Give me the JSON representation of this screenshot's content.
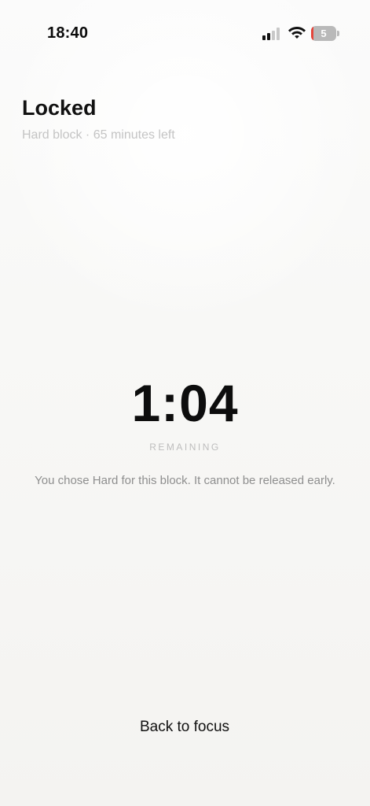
{
  "status_bar": {
    "time": "18:40",
    "signal_icon": "cellular-signal-icon",
    "signal_bars_active": 2,
    "signal_bars_total": 4,
    "wifi_icon": "wifi-icon",
    "battery_icon": "battery-icon",
    "battery_level": "5",
    "battery_fill_color": "#e5453b"
  },
  "header": {
    "title": "Locked",
    "subtitle": "Hard block · 65 minutes left"
  },
  "timer": {
    "value": "1:04",
    "caption": "REMAINING",
    "message": "You chose Hard for this block. It cannot be released early."
  },
  "footer": {
    "back_label": "Back to focus"
  },
  "colors": {
    "text_primary": "#111111",
    "text_muted": "#8e8e8e",
    "text_faint": "#c4c4c4",
    "background": "#f8f8f6"
  }
}
